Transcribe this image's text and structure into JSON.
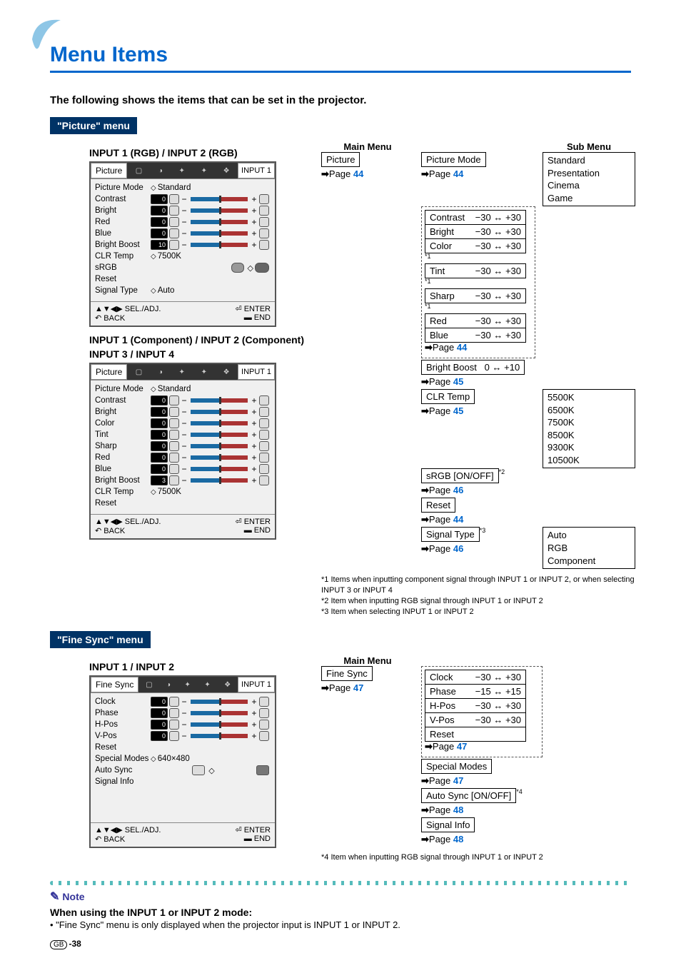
{
  "title": "Menu Items",
  "intro": "The following shows the items that can be set in the projector.",
  "sections": {
    "picture": {
      "header": "\"Picture\" menu",
      "osd1_title": "INPUT 1 (RGB) / INPUT 2 (RGB)",
      "osd2_title_a": "INPUT 1 (Component) / INPUT 2 (Component)",
      "osd2_title_b": "INPUT 3 / INPUT 4",
      "osd_tab": "Picture",
      "osd_input": "INPUT 1",
      "rows_rgb": [
        {
          "lbl": "Picture Mode",
          "type": "diamond",
          "val": "Standard"
        },
        {
          "lbl": "Contrast",
          "type": "slider",
          "num": "0"
        },
        {
          "lbl": "Bright",
          "type": "slider",
          "num": "0"
        },
        {
          "lbl": "Red",
          "type": "slider",
          "num": "0"
        },
        {
          "lbl": "Blue",
          "type": "slider",
          "num": "0"
        },
        {
          "lbl": "Bright Boost",
          "type": "slider",
          "num": "10"
        },
        {
          "lbl": "CLR Temp",
          "type": "diamond",
          "val": "7500K"
        },
        {
          "lbl": "sRGB",
          "type": "toggle"
        },
        {
          "lbl": "Reset",
          "type": "plain"
        },
        {
          "lbl": "Signal Type",
          "type": "diamond",
          "val": "Auto"
        }
      ],
      "rows_comp": [
        {
          "lbl": "Picture Mode",
          "type": "diamond",
          "val": "Standard"
        },
        {
          "lbl": "Contrast",
          "type": "slider",
          "num": "0"
        },
        {
          "lbl": "Bright",
          "type": "slider",
          "num": "0"
        },
        {
          "lbl": "Color",
          "type": "slider",
          "num": "0"
        },
        {
          "lbl": "Tint",
          "type": "slider",
          "num": "0"
        },
        {
          "lbl": "Sharp",
          "type": "slider",
          "num": "0"
        },
        {
          "lbl": "Red",
          "type": "slider",
          "num": "0"
        },
        {
          "lbl": "Blue",
          "type": "slider",
          "num": "0"
        },
        {
          "lbl": "Bright Boost",
          "type": "slider",
          "num": "3"
        },
        {
          "lbl": "CLR Temp",
          "type": "diamond",
          "val": "7500K"
        },
        {
          "lbl": "Reset",
          "type": "plain"
        }
      ],
      "footer": {
        "sel": "SEL./ADJ.",
        "enter": "ENTER",
        "back": "BACK",
        "end": "END"
      }
    },
    "finesync": {
      "header": "\"Fine Sync\" menu",
      "osd_title": "INPUT 1 / INPUT 2",
      "osd_tab": "Fine Sync",
      "osd_input": "INPUT 1",
      "rows": [
        {
          "lbl": "Clock",
          "type": "slider",
          "num": "0"
        },
        {
          "lbl": "Phase",
          "type": "slider",
          "num": "0"
        },
        {
          "lbl": "H-Pos",
          "type": "slider",
          "num": "0"
        },
        {
          "lbl": "V-Pos",
          "type": "slider",
          "num": "0"
        },
        {
          "lbl": "Reset",
          "type": "plain"
        },
        {
          "lbl": "Special Modes",
          "type": "diamond",
          "val": "640×480"
        },
        {
          "lbl": "Auto Sync",
          "type": "autosync"
        },
        {
          "lbl": "Signal Info",
          "type": "plain"
        }
      ]
    }
  },
  "tree": {
    "mainmenu": "Main Menu",
    "submenu": "Sub Menu",
    "picture": {
      "root": "Picture",
      "root_page": "44",
      "pic_mode": {
        "lbl": "Picture Mode",
        "page": "44",
        "options": [
          "Standard",
          "Presentation",
          "Cinema",
          "Game"
        ]
      },
      "sliders": [
        {
          "lbl": "Contrast",
          "range": "−30 ↔ +30",
          "note": ""
        },
        {
          "lbl": "Bright",
          "range": "−30 ↔ +30",
          "note": ""
        },
        {
          "lbl": "Color",
          "range": "−30 ↔ +30",
          "note": "*1"
        },
        {
          "lbl": "Tint",
          "range": "−30 ↔ +30",
          "note": "*1"
        },
        {
          "lbl": "Sharp",
          "range": "−30 ↔ +30",
          "note": "*1"
        },
        {
          "lbl": "Red",
          "range": "−30 ↔ +30",
          "note": ""
        },
        {
          "lbl": "Blue",
          "range": "−30 ↔ +30",
          "note": ""
        }
      ],
      "sliders_page": "44",
      "bb": {
        "lbl": "Bright Boost",
        "range": "0 ↔ +10",
        "page": "45"
      },
      "clr": {
        "lbl": "CLR Temp",
        "page": "45",
        "options": [
          "5500K",
          "6500K",
          "7500K",
          "8500K",
          "9300K",
          "10500K"
        ]
      },
      "srgb": {
        "lbl": "sRGB [ON/OFF]",
        "note": "*2",
        "page": "46"
      },
      "reset": {
        "lbl": "Reset",
        "page": "44"
      },
      "sig": {
        "lbl": "Signal Type",
        "note": "*3",
        "page": "46",
        "options": [
          "Auto",
          "RGB",
          "Component"
        ]
      }
    },
    "finesync": {
      "root": "Fine Sync",
      "root_page": "47",
      "sliders": [
        {
          "lbl": "Clock",
          "range": "−30 ↔ +30"
        },
        {
          "lbl": "Phase",
          "range": "−15 ↔ +15"
        },
        {
          "lbl": "H-Pos",
          "range": "−30 ↔ +30"
        },
        {
          "lbl": "V-Pos",
          "range": "−30 ↔ +30"
        }
      ],
      "reset": {
        "lbl": "Reset",
        "page": "47"
      },
      "special": {
        "lbl": "Special Modes",
        "page": "47"
      },
      "auto": {
        "lbl": "Auto Sync [ON/OFF]",
        "note": "*4",
        "page": "48"
      },
      "siginfo": {
        "lbl": "Signal Info",
        "page": "48"
      }
    }
  },
  "footnotes_pic": [
    "*1 Items when inputting component signal through INPUT 1 or INPUT 2, or when selecting INPUT 3 or INPUT 4",
    "*2 Item when inputting RGB signal through INPUT 1 or INPUT 2",
    "*3 Item when selecting INPUT 1 or INPUT 2"
  ],
  "footnotes_fs": [
    "*4  Item when inputting RGB signal through INPUT 1 or INPUT 2"
  ],
  "note": {
    "label": "Note",
    "heading": "When using the INPUT 1 or INPUT 2 mode:",
    "text": "• \"Fine Sync\" menu is only displayed when the projector input is INPUT 1 or INPUT 2."
  },
  "pagenum": {
    "region": "GB",
    "num": "-38"
  }
}
